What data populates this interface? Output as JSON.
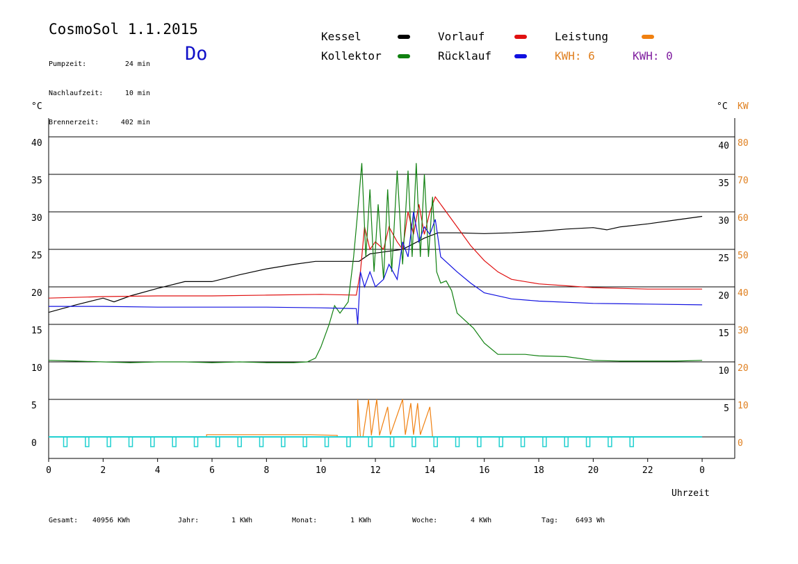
{
  "header": {
    "title": "CosmoSol 1.1.2015",
    "info": [
      {
        "label": "Pumpzeit:",
        "value": "24 min"
      },
      {
        "label": "Nachlaufzeit:",
        "value": "10 min"
      },
      {
        "label": "Brennerzeit:",
        "value": "402 min"
      }
    ],
    "day": "Do"
  },
  "legend": {
    "items": [
      {
        "label": "Kessel",
        "color": "#000000"
      },
      {
        "label": "Vorlauf",
        "color": "#e01010"
      },
      {
        "label": "Leistung",
        "color": "#f08010"
      },
      {
        "label": "Kollektor",
        "color": "#108010"
      },
      {
        "label": "Rücklauf",
        "color": "#1010e0"
      }
    ],
    "kwh1": "KWH: 6",
    "kwh1_color": "#e08020",
    "kwh2": "KWH: 0",
    "kwh2_color": "#8020a0"
  },
  "chart_data": {
    "type": "line",
    "xlabel": "Uhrzeit",
    "ylabel_left": "°C",
    "ylabel_right_temp": "°C",
    "ylabel_right_power": "KW",
    "xlim": [
      0,
      24
    ],
    "ylim": [
      -3,
      43
    ],
    "x_ticks": [
      "0",
      "2",
      "4",
      "6",
      "8",
      "10",
      "12",
      "14",
      "16",
      "18",
      "20",
      "22",
      "0"
    ],
    "y_ticks_left": [
      "0",
      "5",
      "10",
      "15",
      "20",
      "25",
      "30",
      "35",
      "40"
    ],
    "y_ticks_right_temp": [
      "5",
      "10",
      "15",
      "20",
      "25",
      "30",
      "35",
      "40"
    ],
    "y_ticks_right_power": [
      "0",
      "10",
      "20",
      "30",
      "40",
      "50",
      "60",
      "70",
      "80"
    ],
    "grid": "horizontal",
    "series": [
      {
        "name": "Kessel",
        "color": "#000000",
        "x": [
          0,
          1,
          2,
          2.4,
          3,
          4,
          5,
          6,
          7,
          8,
          9,
          9.8,
          10.5,
          11.4,
          11.8,
          12.2,
          13,
          13.8,
          14.3,
          15,
          16,
          17,
          18,
          19,
          20,
          20.5,
          21,
          22,
          23,
          24
        ],
        "values": [
          16.6,
          17.6,
          18.5,
          18.0,
          18.8,
          19.8,
          20.7,
          20.7,
          21.6,
          22.4,
          23.0,
          23.4,
          23.4,
          23.4,
          24.4,
          24.6,
          25.0,
          26.5,
          27.2,
          27.2,
          27.1,
          27.2,
          27.4,
          27.7,
          27.9,
          27.6,
          28.0,
          28.4,
          28.9,
          29.4
        ]
      },
      {
        "name": "Vorlauf",
        "color": "#e01010",
        "x": [
          0,
          2,
          4,
          6,
          8,
          10,
          11.3,
          11.45,
          11.6,
          11.8,
          12,
          12.3,
          12.5,
          12.8,
          13,
          13.2,
          13.4,
          13.6,
          13.8,
          14,
          14.2,
          14.4,
          15,
          15.5,
          16,
          16.5,
          17,
          18,
          20,
          22,
          24
        ],
        "values": [
          18.5,
          18.7,
          18.8,
          18.8,
          18.9,
          19.0,
          18.9,
          22,
          28,
          25,
          26,
          25,
          28,
          26,
          25,
          30,
          27,
          31,
          27,
          30,
          32,
          31,
          28,
          25.5,
          23.5,
          22,
          21,
          20.4,
          19.9,
          19.7,
          19.7
        ]
      },
      {
        "name": "Kollektor",
        "color": "#108010",
        "x": [
          0,
          1,
          2,
          3,
          4,
          5,
          6,
          7,
          8,
          9,
          9.5,
          9.8,
          10,
          10.3,
          10.5,
          10.7,
          11,
          11.2,
          11.35,
          11.5,
          11.65,
          11.8,
          11.95,
          12.1,
          12.3,
          12.45,
          12.6,
          12.8,
          13.0,
          13.2,
          13.35,
          13.5,
          13.65,
          13.8,
          13.95,
          14.1,
          14.25,
          14.4,
          14.6,
          14.8,
          15,
          15.3,
          15.6,
          16,
          16.5,
          17,
          17.5,
          18,
          19,
          20,
          21,
          22,
          23,
          24
        ],
        "values": [
          10.2,
          10.1,
          10.0,
          9.9,
          10.0,
          10.0,
          9.9,
          10.0,
          9.9,
          9.9,
          10.0,
          10.5,
          12,
          15,
          17.5,
          16.5,
          18,
          24,
          30,
          36.5,
          24,
          33,
          22,
          31,
          21,
          33,
          22,
          35.5,
          23,
          35.5,
          24,
          36.5,
          24,
          35,
          24,
          32,
          22,
          20.5,
          20.8,
          19.5,
          16.5,
          15.5,
          14.5,
          12.5,
          11.0,
          11.0,
          11.0,
          10.8,
          10.7,
          10.2,
          10.1,
          10.1,
          10.1,
          10.2
        ]
      },
      {
        "name": "Rücklauf",
        "color": "#1010e0",
        "x": [
          0,
          2,
          4,
          6,
          8,
          10,
          11.3,
          11.35,
          11.45,
          11.6,
          11.8,
          12,
          12.3,
          12.5,
          12.8,
          13,
          13.2,
          13.4,
          13.6,
          13.8,
          14,
          14.2,
          14.4,
          15,
          15.5,
          16,
          17,
          18,
          20,
          22,
          24
        ],
        "values": [
          17.4,
          17.4,
          17.3,
          17.3,
          17.3,
          17.2,
          17.1,
          15,
          22,
          20,
          22,
          20,
          21,
          23,
          21,
          26,
          24,
          30,
          26,
          28,
          27,
          29,
          24,
          22,
          20.5,
          19.2,
          18.4,
          18.1,
          17.8,
          17.7,
          17.6
        ]
      },
      {
        "name": "Leistung",
        "color": "#f08010",
        "x": [
          0,
          5.8,
          5.8,
          9.6,
          10.6,
          10.6,
          11.35,
          11.35,
          11.45,
          11.55,
          11.55,
          11.75,
          11.85,
          11.85,
          12.05,
          12.15,
          12.15,
          12.45,
          12.55,
          12.55,
          13,
          13.1,
          13.1,
          13.3,
          13.4,
          13.4,
          13.55,
          13.65,
          13.65,
          14,
          14.1,
          14.1,
          24
        ],
        "values": [
          0,
          0,
          0.3,
          0.3,
          0.2,
          0,
          0,
          5,
          0,
          0,
          0.2,
          5,
          0.3,
          0.2,
          5,
          0.4,
          0.2,
          4,
          0.3,
          0.3,
          5,
          0.3,
          0.3,
          4.5,
          0.3,
          0.3,
          4.5,
          0.3,
          0.3,
          4,
          0,
          0,
          0
        ]
      }
    ]
  },
  "footer": {
    "gesamt_label": "Gesamt:",
    "gesamt_value": "40956 KWh",
    "jahr_label": "Jahr:",
    "jahr_value": "1 KWh",
    "monat_label": "Monat:",
    "monat_value": "1 KWh",
    "woche_label": "Woche:",
    "woche_value": "4 KWh",
    "tag_label": "Tag:",
    "tag_value": "6493 Wh"
  }
}
